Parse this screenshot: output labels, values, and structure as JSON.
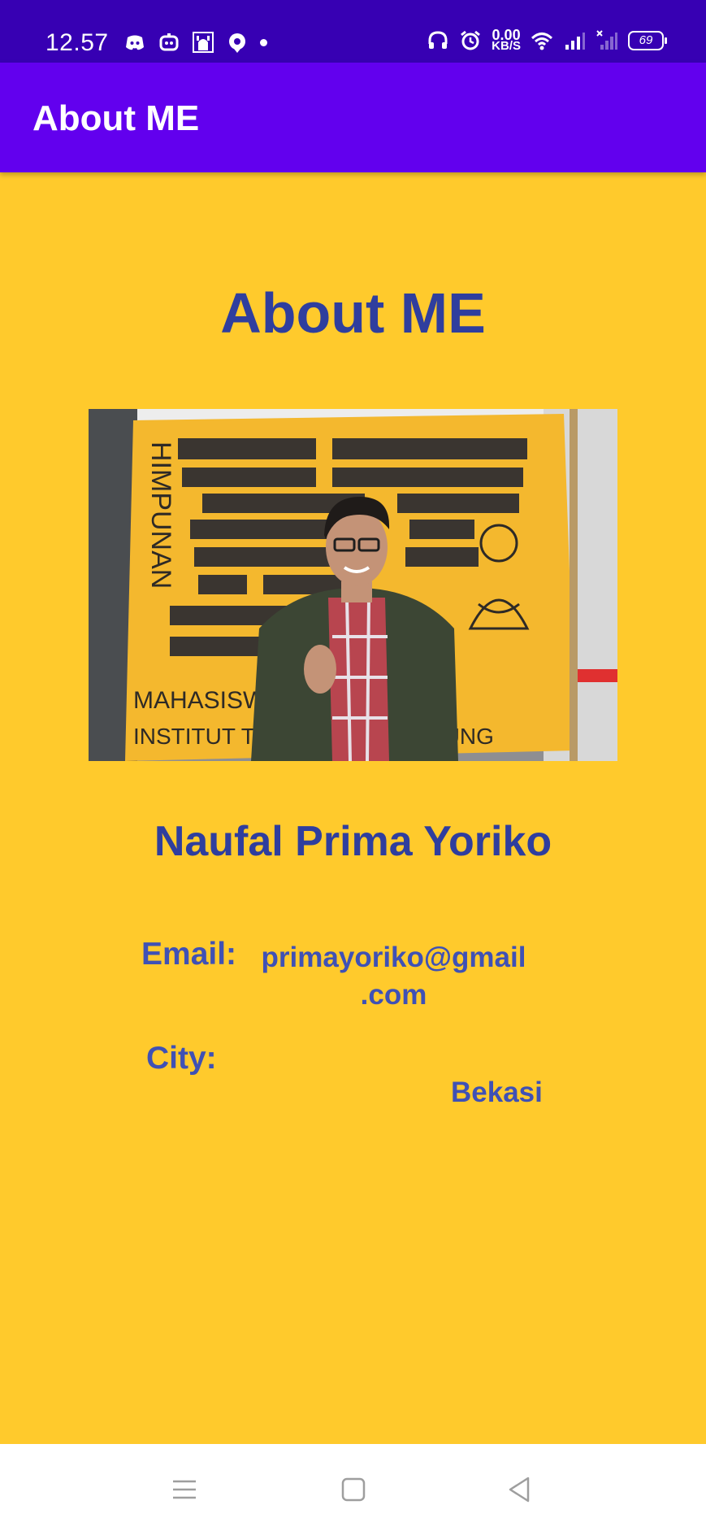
{
  "status_bar": {
    "time": "12.57",
    "left_icons": [
      "discord-icon",
      "bot-icon",
      "prayer-icon",
      "location-pin-icon",
      "dot-icon"
    ],
    "net_speed_value": "0.00",
    "net_speed_unit": "KB/S",
    "right_icons": [
      "headset-icon",
      "alarm-icon",
      "wifi-icon",
      "signal-icon",
      "signal-no-service-icon"
    ],
    "battery": "69"
  },
  "app_bar": {
    "title": "About ME"
  },
  "main": {
    "heading": "About ME",
    "name": "Naufal Prima Yoriko",
    "email_label": "Email:",
    "email_value": "primayoriko@gmail\n.com",
    "city_label": "City:",
    "city_value": "Bekasi"
  },
  "photo_banner_text": {
    "left": "HIMPUNAN",
    "bottom_1": "MAHASISWA INFORMATIKA",
    "bottom_2": "INSTITUT TEKNOLOGI BANDUNG"
  },
  "nav_bar": {
    "buttons": [
      "menu-icon",
      "home-icon",
      "back-icon"
    ]
  },
  "colors": {
    "status_bar": "#3700B3",
    "app_bar": "#6200EE",
    "background": "#FFCA2C",
    "heading_text": "#2F3E9E",
    "field_text": "#3F51B5"
  }
}
